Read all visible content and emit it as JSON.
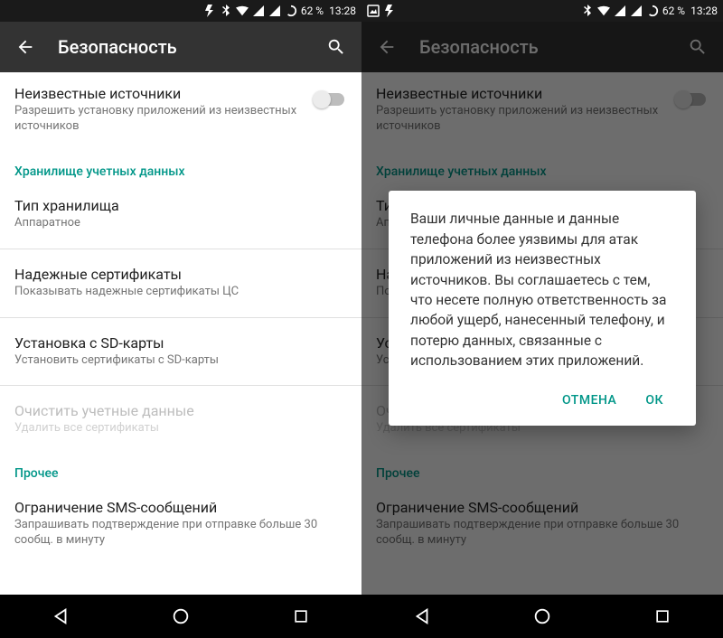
{
  "statusbar": {
    "battery": "62 %",
    "time": "13:28"
  },
  "toolbar": {
    "title": "Безопасность"
  },
  "settings": {
    "unknown_sources": {
      "title": "Неизвестные источники",
      "sub": "Разрешить установку приложений из неизвестных источников"
    },
    "section_credstore": "Хранилище учетных данных",
    "storage_type": {
      "title": "Тип хранилища",
      "sub": "Аппаратное"
    },
    "trusted_certs": {
      "title": "Надежные сертификаты",
      "sub": "Показывать надежные сертификаты ЦС"
    },
    "install_sd": {
      "title": "Установка с SD-карты",
      "sub": "Установить сертификаты с SD-карты"
    },
    "clear_creds": {
      "title": "Очистить учетные данные",
      "sub": "Удалить все сертификаты"
    },
    "section_other": "Прочее",
    "sms_limit": {
      "title": "Ограничение SMS-сообщений",
      "sub": "Запрашивать подтверждение при отправке больше 30 сообщ. в минуту"
    }
  },
  "dialog": {
    "text": "Ваши личные данные и данные телефона более уязвимы для атак приложений из неизвестных источников. Вы соглашаетесь с тем, что несете полную ответственность за любой ущерб, нанесенный телефону, и потерю данных, связанные с использованием этих приложений.",
    "cancel": "ОТМЕНА",
    "ok": "ОК"
  }
}
